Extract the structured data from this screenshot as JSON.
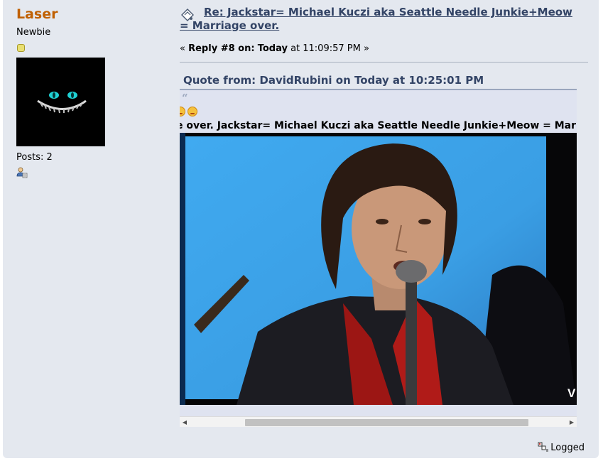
{
  "poster": {
    "name": "Laser",
    "group": "Newbie",
    "posts": "Posts: 2",
    "star_icon": "star-icon",
    "profile_icon": "profile-icon"
  },
  "post": {
    "subject": "Re: Jackstar= Michael Kuczi aka Seattle Needle Junkie+Meow = Marriage over.",
    "reply_prefix": "«",
    "reply_label": "Reply #8 on:",
    "reply_day": "Today",
    "reply_time": "at 11:09:57 PM",
    "reply_suffix": "»",
    "icon": "xx-icon"
  },
  "quote": {
    "header": "Quote from: DavidRubini on Today at 10:25:01 PM",
    "text": "e over. Jackstar= Michael Kuczi aka Seattle Needle Junkie+Meow = Marriage over."
  },
  "video": {
    "watermark": "V"
  },
  "footer": {
    "logged_label": "Logged"
  },
  "colors": {
    "background": "#e4e8ef",
    "poster_name": "#c06002",
    "subject": "#334466"
  }
}
